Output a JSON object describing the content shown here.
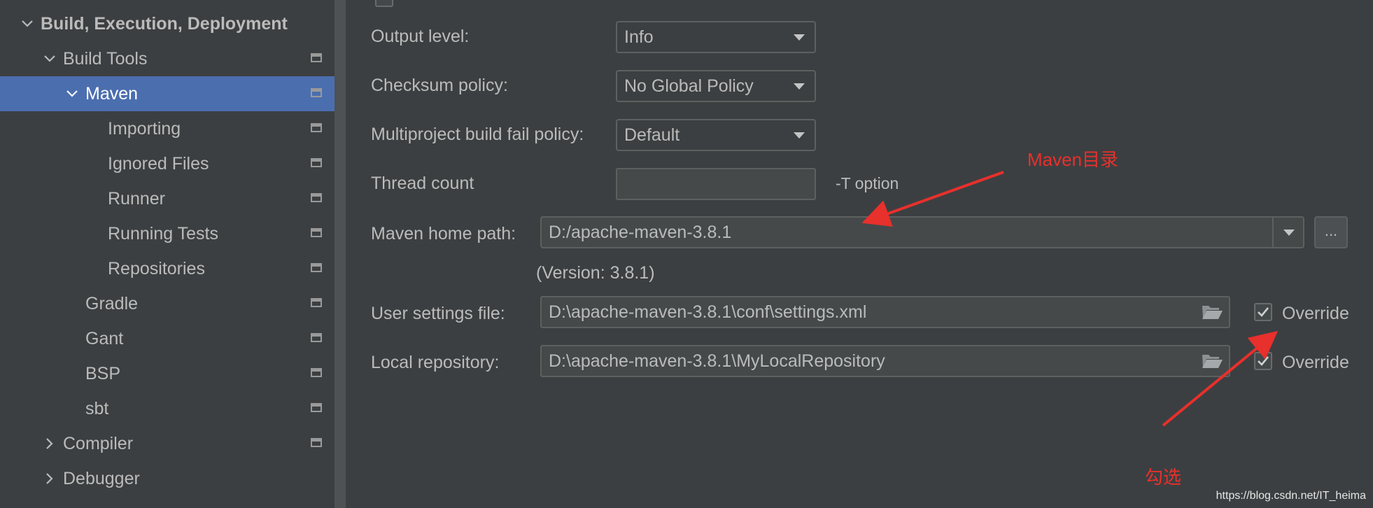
{
  "sidebar": {
    "items": [
      {
        "label": "Build, Execution, Deployment"
      },
      {
        "label": "Build Tools"
      },
      {
        "label": "Maven"
      },
      {
        "label": "Importing"
      },
      {
        "label": "Ignored Files"
      },
      {
        "label": "Runner"
      },
      {
        "label": "Running Tests"
      },
      {
        "label": "Repositories"
      },
      {
        "label": "Gradle"
      },
      {
        "label": "Gant"
      },
      {
        "label": "BSP"
      },
      {
        "label": "sbt"
      },
      {
        "label": "Compiler"
      },
      {
        "label": "Debugger"
      }
    ]
  },
  "settings": {
    "output_level": {
      "label": "Output level:",
      "value": "Info"
    },
    "checksum_policy": {
      "label": "Checksum policy:",
      "value": "No Global Policy"
    },
    "multiproject_fail": {
      "label": "Multiproject build fail policy:",
      "value": "Default"
    },
    "thread_count": {
      "label": "Thread count",
      "value": "",
      "hint": "-T option"
    },
    "maven_home": {
      "label": "Maven home path:",
      "value": "D:/apache-maven-3.8.1",
      "browse_label": "...",
      "version": "(Version: 3.8.1)"
    },
    "user_settings": {
      "label": "User settings file:",
      "value": "D:\\apache-maven-3.8.1\\conf\\settings.xml",
      "override_label": "Override",
      "override_checked": true
    },
    "local_repo": {
      "label": "Local repository:",
      "value": "D:\\apache-maven-3.8.1\\MyLocalRepository",
      "override_label": "Override",
      "override_checked": true
    }
  },
  "annotations": {
    "maven_dir": "Maven目录",
    "check": "勾选",
    "color": "#e8302c"
  },
  "watermark": "https://blog.csdn.net/IT_heima",
  "colors": {
    "background": "#3c3f41",
    "selected": "#4b6eaf",
    "text": "#bbbbbb"
  }
}
